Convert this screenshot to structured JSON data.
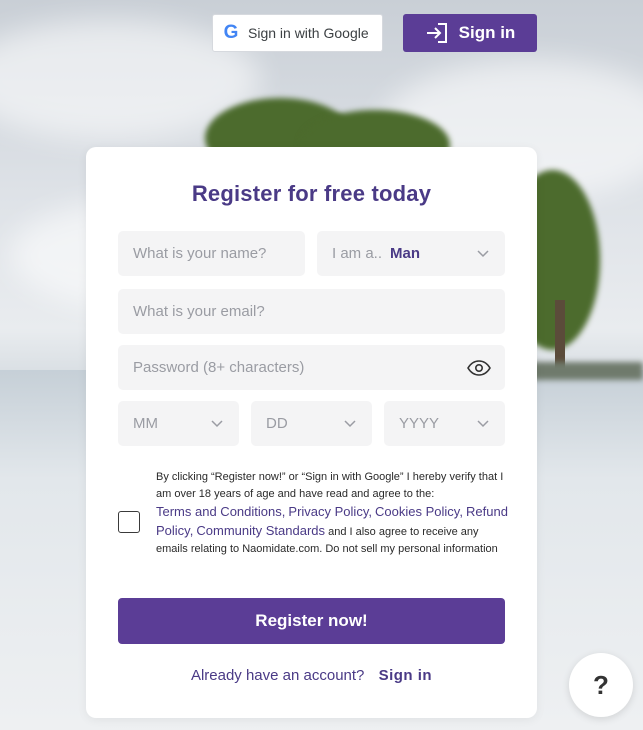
{
  "top_bar": {
    "google_label": "Sign in with Google",
    "google_icon": "google-g-icon",
    "signin_label": "Sign in",
    "signin_icon": "sign-in-arrow-icon"
  },
  "form": {
    "title": "Register for free today",
    "name_placeholder": "What is your name?",
    "gender_label": "I am a..",
    "gender_value": "Man",
    "email_placeholder": "What is your email?",
    "password_placeholder": "Password (8+ characters)",
    "dob": {
      "month": "MM",
      "day": "DD",
      "year": "YYYY"
    },
    "consent": {
      "text_before": "By clicking “Register now!” or “Sign in with Google” I hereby verify that I am over 18 years of age and have read and agree to the:",
      "links": [
        "Terms and Conditions,",
        "Privacy Policy,",
        "Cookies Policy,",
        "Refund Policy,",
        "Community Standards"
      ],
      "text_after": "and I also agree to receive any emails relating to Naomidate.com. Do not sell my personal information"
    },
    "register_label": "Register now!",
    "already_text": "Already have an account?",
    "already_link": "Sign in"
  },
  "help": {
    "label": "?"
  },
  "colors": {
    "brand": "#5b3d96",
    "title": "#4a3a86",
    "field_bg": "#f4f4f5"
  }
}
